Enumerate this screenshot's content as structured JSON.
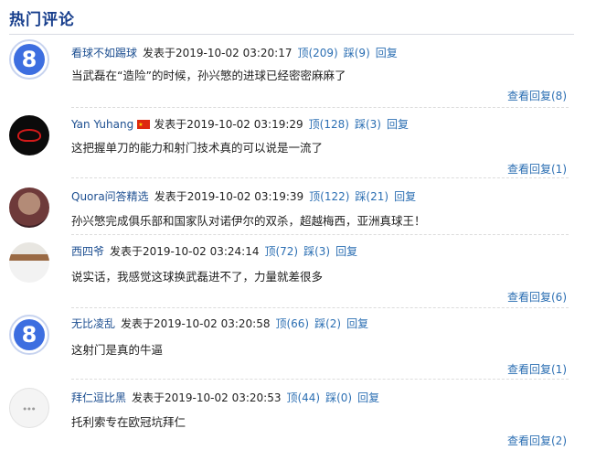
{
  "section": {
    "title": "热门评论"
  },
  "comments": [
    {
      "user": "看球不如踢球",
      "posted": "发表于2019-10-02 03:20:17",
      "up": "顶(209)",
      "down": "踩(9)",
      "reply": "回复",
      "text": "当武磊在“造险”的时候，孙兴慜的进球已经密密麻麻了",
      "view_replies": "查看回复(8)",
      "avatar": "blue-eight-avatar"
    },
    {
      "user": "Yan Yuhang",
      "posted": "发表于2019-10-02 03:19:29",
      "up": "顶(128)",
      "down": "踩(3)",
      "reply": "回复",
      "text": "这把握单刀的能力和射门技术真的可以说是一流了",
      "view_replies": "查看回复(1)",
      "avatar": "rog-logo-avatar"
    },
    {
      "user": "Quora问答精选",
      "posted": "发表于2019-10-02 03:19:39",
      "up": "顶(122)",
      "down": "踩(21)",
      "reply": "回复",
      "text": "孙兴慜完成俱乐部和国家队对诺伊尔的双杀，超越梅西，亚洲真球王！",
      "view_replies": "",
      "avatar": "quora-avatar"
    },
    {
      "user": "西四爷",
      "posted": "发表于2019-10-02 03:24:14",
      "up": "顶(72)",
      "down": "踩(3)",
      "reply": "回复",
      "text": "说实话，我感觉这球换武磊进不了，力量就差很多",
      "view_replies": "查看回复(6)",
      "avatar": "person-avatar"
    },
    {
      "user": "无比凌乱",
      "posted": "发表于2019-10-02 03:20:58",
      "up": "顶(66)",
      "down": "踩(2)",
      "reply": "回复",
      "text": "这射门是真的牛逼",
      "view_replies": "查看回复(1)",
      "avatar": "blue-eight-avatar"
    },
    {
      "user": "拜仁逗比黑",
      "posted": "发表于2019-10-02 03:20:53",
      "up": "顶(44)",
      "down": "踩(0)",
      "reply": "回复",
      "text": "托利索专在欧冠坑拜仁",
      "view_replies": "查看回复(2)",
      "avatar": "bayern-avatar"
    }
  ]
}
